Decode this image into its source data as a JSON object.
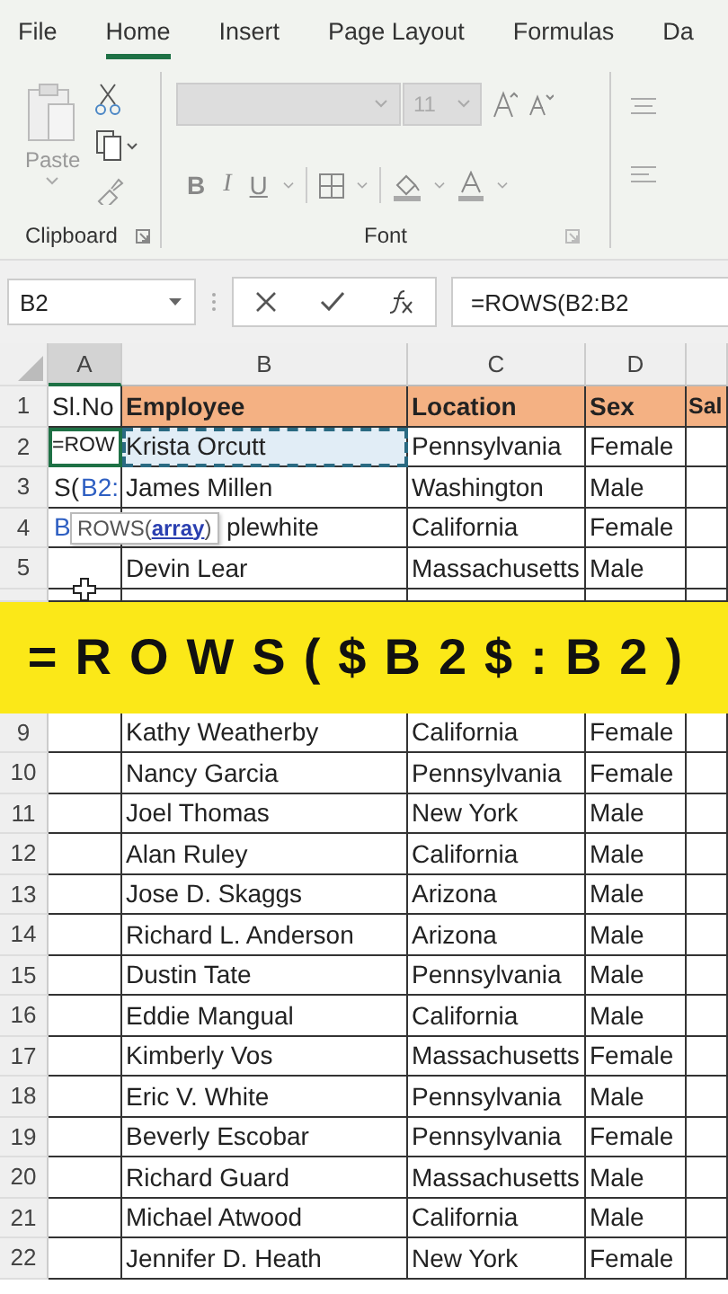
{
  "ribbon_tabs": [
    {
      "label": "File",
      "selected": false
    },
    {
      "label": "Home",
      "selected": true
    },
    {
      "label": "Insert",
      "selected": false
    },
    {
      "label": "Page Layout",
      "selected": false
    },
    {
      "label": "Formulas",
      "selected": false
    },
    {
      "label": "Da",
      "selected": false
    }
  ],
  "clipboard": {
    "paste_label": "Paste",
    "group_label": "Clipboard"
  },
  "font_group": {
    "font_size": "11",
    "bold": "B",
    "italic": "I",
    "underline": "U",
    "group_label": "Font"
  },
  "formula_bar": {
    "name_box": "B2",
    "formula": "=ROWS(B2:B2"
  },
  "columns": [
    "A",
    "B",
    "C",
    "D"
  ],
  "header_row": {
    "number": "1",
    "cells": [
      "Sl.No",
      "Employee",
      "Location",
      "Sex",
      "Sal"
    ]
  },
  "rows": [
    {
      "number": "2",
      "a": [
        {
          "text": "=ROW",
          "ref": false
        }
      ],
      "b": "Krista Orcutt",
      "c": "Pennsylvania",
      "d": "Female",
      "selected": true
    },
    {
      "number": "3",
      "a": [
        {
          "text": "S(",
          "ref": false
        },
        {
          "text": "B2:",
          "ref": true
        }
      ],
      "b": "James Millen",
      "c": "Washington",
      "d": "Male",
      "selected": false
    },
    {
      "number": "4",
      "a": [
        {
          "text": "B",
          "ref": true
        }
      ],
      "b": "plewhite",
      "c": "California",
      "d": "Female",
      "selected": false
    },
    {
      "number": "5",
      "a": [],
      "b": "Devin Lear",
      "c": "Massachusetts",
      "d": "Male",
      "selected": false
    }
  ],
  "tooltip": {
    "name": "ROWS(",
    "arg": "array",
    "close": ")"
  },
  "banner": {
    "text": "=ROWS($B2$:B2)"
  },
  "rows_below": [
    {
      "number": "9",
      "b": "Kathy Weatherby",
      "c": "California",
      "d": "Female"
    },
    {
      "number": "10",
      "b": "Nancy Garcia",
      "c": "Pennsylvania",
      "d": "Female"
    },
    {
      "number": "11",
      "b": "Joel Thomas",
      "c": "New York",
      "d": "Male"
    },
    {
      "number": "12",
      "b": "Alan Ruley",
      "c": "California",
      "d": "Male"
    },
    {
      "number": "13",
      "b": "Jose D. Skaggs",
      "c": "Arizona",
      "d": "Male"
    },
    {
      "number": "14",
      "b": "Richard L. Anderson",
      "c": "Arizona",
      "d": "Male"
    },
    {
      "number": "15",
      "b": "Dustin Tate",
      "c": "Pennsylvania",
      "d": "Male"
    },
    {
      "number": "16",
      "b": "Eddie Mangual",
      "c": "California",
      "d": "Male"
    },
    {
      "number": "17",
      "b": "Kimberly Vos",
      "c": "Massachusetts",
      "d": "Female"
    },
    {
      "number": "18",
      "b": "Eric V. White",
      "c": "Pennsylvania",
      "d": "Male"
    },
    {
      "number": "19",
      "b": "Beverly Escobar",
      "c": "Pennsylvania",
      "d": "Female"
    },
    {
      "number": "20",
      "b": "Richard Guard",
      "c": "Massachusetts",
      "d": "Male"
    },
    {
      "number": "21",
      "b": "Michael Atwood",
      "c": "California",
      "d": "Male"
    },
    {
      "number": "22",
      "b": "Jennifer D. Heath",
      "c": "New York",
      "d": "Female"
    }
  ]
}
